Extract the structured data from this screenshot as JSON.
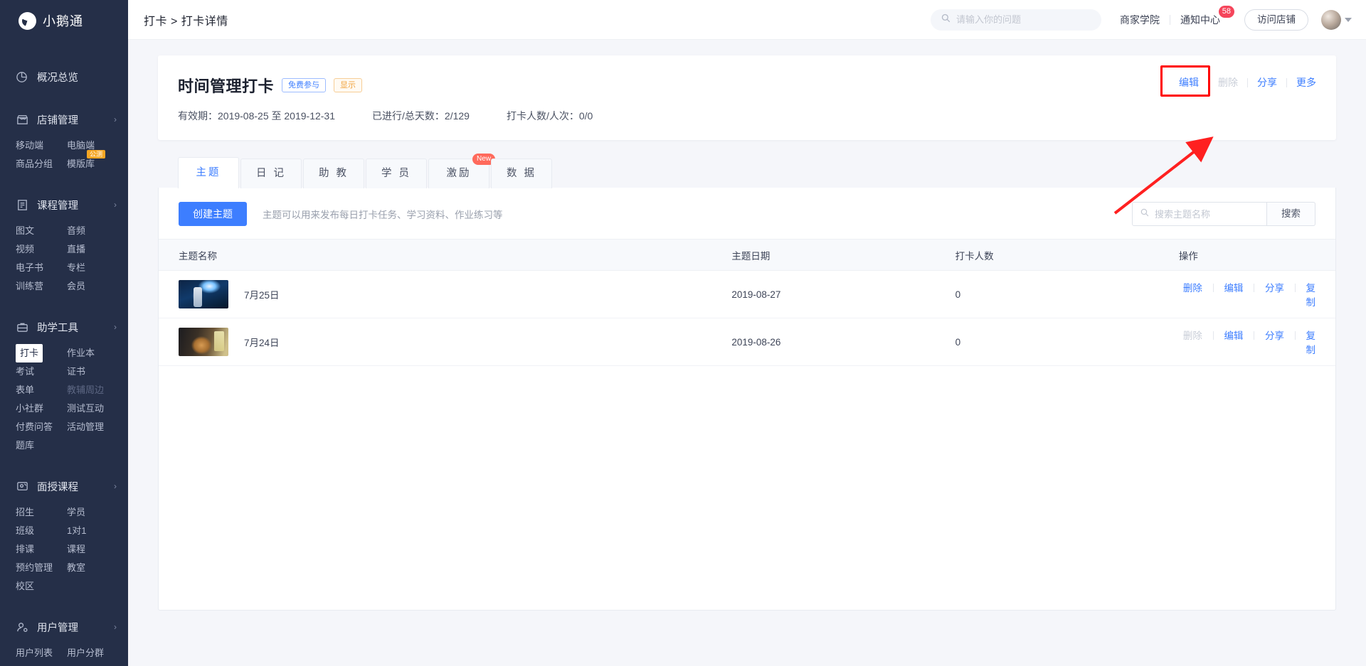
{
  "brand": {
    "name": "小鹅通",
    "logo_icon": "goose-logo-icon"
  },
  "sidebar": {
    "overview": {
      "label": "概况总览",
      "icon": "pie-chart-icon"
    },
    "groups": [
      {
        "label": "店铺管理",
        "icon": "shop-icon",
        "chevron": "›",
        "items": [
          {
            "label": "移动端",
            "state": "normal"
          },
          {
            "label": "电脑端",
            "state": "normal"
          },
          {
            "label": "商品分组",
            "state": "normal"
          },
          {
            "label": "模版库",
            "state": "normal",
            "badge": "公测"
          }
        ]
      },
      {
        "label": "课程管理",
        "icon": "book-icon",
        "chevron": "›",
        "items": [
          {
            "label": "图文",
            "state": "normal"
          },
          {
            "label": "音频",
            "state": "normal"
          },
          {
            "label": "视频",
            "state": "normal"
          },
          {
            "label": "直播",
            "state": "normal"
          },
          {
            "label": "电子书",
            "state": "normal"
          },
          {
            "label": "专栏",
            "state": "normal"
          },
          {
            "label": "训练营",
            "state": "normal"
          },
          {
            "label": "会员",
            "state": "normal"
          }
        ]
      },
      {
        "label": "助学工具",
        "icon": "toolbox-icon",
        "chevron": "›",
        "items": [
          {
            "label": "打卡",
            "state": "active"
          },
          {
            "label": "作业本",
            "state": "normal"
          },
          {
            "label": "考试",
            "state": "normal"
          },
          {
            "label": "证书",
            "state": "normal"
          },
          {
            "label": "表单",
            "state": "normal"
          },
          {
            "label": "教辅周边",
            "state": "disabled"
          },
          {
            "label": "小社群",
            "state": "normal"
          },
          {
            "label": "测试互动",
            "state": "normal"
          },
          {
            "label": "付费问答",
            "state": "normal"
          },
          {
            "label": "活动管理",
            "state": "normal"
          },
          {
            "label": "题库",
            "state": "normal"
          }
        ]
      },
      {
        "label": "面授课程",
        "icon": "teacher-icon",
        "chevron": "›",
        "items": [
          {
            "label": "招生",
            "state": "normal"
          },
          {
            "label": "学员",
            "state": "normal"
          },
          {
            "label": "班级",
            "state": "normal"
          },
          {
            "label": "1对1",
            "state": "normal"
          },
          {
            "label": "排课",
            "state": "normal"
          },
          {
            "label": "课程",
            "state": "normal"
          },
          {
            "label": "预约管理",
            "state": "normal"
          },
          {
            "label": "教室",
            "state": "normal"
          },
          {
            "label": "校区",
            "state": "normal"
          }
        ]
      },
      {
        "label": "用户管理",
        "icon": "user-gear-icon",
        "chevron": "›",
        "items": [
          {
            "label": "用户列表",
            "state": "normal"
          },
          {
            "label": "用户分群",
            "state": "normal"
          }
        ]
      }
    ]
  },
  "topbar": {
    "breadcrumb": "打卡 > 打卡详情",
    "search_placeholder": "请输入你的问题",
    "search_value": "",
    "search_icon": "search-icon",
    "merchant_academy": "商家学院",
    "notification_center": "通知中心",
    "notification_count": "58",
    "visit_shop": "访问店铺",
    "avatar_icon": "user-avatar",
    "caret_icon": "chevron-down-icon"
  },
  "header_card": {
    "title": "时间管理打卡",
    "tag_free": "免费参与",
    "tag_show": "显示",
    "meta": [
      "有效期：2019-08-25 至 2019-12-31",
      "已进行/总天数：2/129",
      "打卡人数/人次：0/0"
    ],
    "actions": [
      {
        "label": "编辑",
        "state": "normal",
        "highlighted": true
      },
      {
        "label": "删除",
        "state": "disabled"
      },
      {
        "label": "分享",
        "state": "normal"
      },
      {
        "label": "更多",
        "state": "normal"
      }
    ],
    "annotation_color": "#ff0000"
  },
  "tabs": [
    {
      "label": "主题",
      "active": true
    },
    {
      "label": "日 记",
      "active": false
    },
    {
      "label": "助 教",
      "active": false
    },
    {
      "label": "学 员",
      "active": false
    },
    {
      "label": "激励",
      "active": false,
      "badge": "New"
    },
    {
      "label": "数 据",
      "active": false
    }
  ],
  "toolbar": {
    "create_label": "创建主题",
    "hint": "主题可以用来发布每日打卡任务、学习资料、作业练习等",
    "search_placeholder": "搜索主题名称",
    "search_value": "",
    "search_icon": "search-icon",
    "search_button": "搜索"
  },
  "table": {
    "columns": [
      "主题名称",
      "主题日期",
      "打卡人数",
      "操作"
    ],
    "rows": [
      {
        "thumb": "concert-photo",
        "name": "7月25日",
        "date": "2019-08-27",
        "count": "0",
        "actions": [
          {
            "label": "删除",
            "state": "normal"
          },
          {
            "label": "编辑",
            "state": "normal"
          },
          {
            "label": "分享",
            "state": "normal"
          },
          {
            "label": "复制",
            "state": "normal"
          }
        ]
      },
      {
        "thumb": "cat-photo",
        "name": "7月24日",
        "date": "2019-08-26",
        "count": "0",
        "actions": [
          {
            "label": "删除",
            "state": "disabled"
          },
          {
            "label": "编辑",
            "state": "normal"
          },
          {
            "label": "分享",
            "state": "normal"
          },
          {
            "label": "复制",
            "state": "normal"
          }
        ]
      }
    ]
  },
  "colors": {
    "sidebar_bg": "#252f48",
    "accent_blue": "#3d7eff",
    "badge_red": "#f5455b",
    "badge_orange": "#f5a623",
    "new_badge": "#ff6a5c",
    "annotation_red": "#ff0000"
  }
}
